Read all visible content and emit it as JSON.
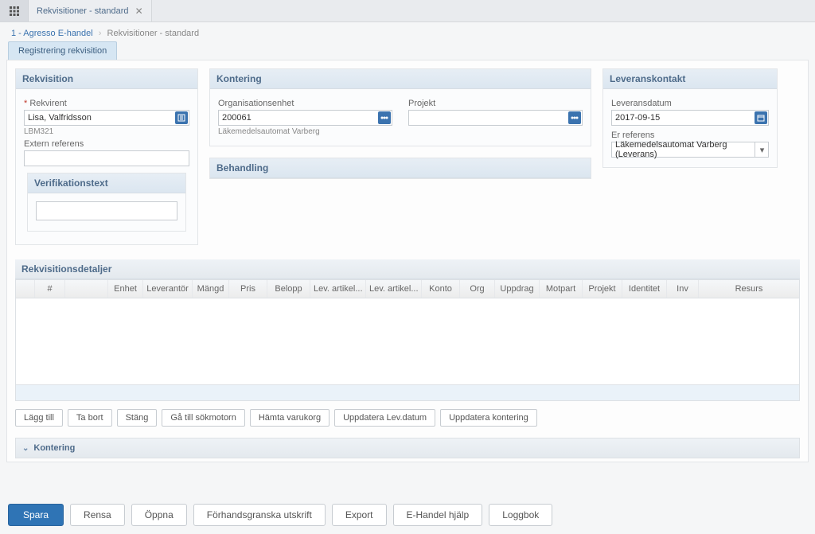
{
  "tab": {
    "title": "Rekvisitioner - standard"
  },
  "breadcrumb": {
    "root": "1 - Agresso E-handel",
    "current": "Rekvisitioner - standard"
  },
  "inner_tab": {
    "label": "Registrering rekvisition"
  },
  "rekvisition": {
    "heading": "Rekvisition",
    "rekvirent_label": "Rekvirent",
    "rekvirent_value": "Lisa, Valfridsson",
    "rekvirent_code": "LBM321",
    "extern_label": "Extern referens",
    "extern_value": "",
    "verif_heading": "Verifikationstext",
    "verif_value": ""
  },
  "kontering": {
    "heading": "Kontering",
    "org_label": "Organisationsenhet",
    "org_value": "200061",
    "org_desc": "Läkemedelsautomat Varberg",
    "projekt_label": "Projekt",
    "projekt_value": ""
  },
  "behandling": {
    "heading": "Behandling"
  },
  "leverans": {
    "heading": "Leveranskontakt",
    "date_label": "Leveransdatum",
    "date_value": "2017-09-15",
    "ref_label": "Er referens",
    "ref_value": "Läkemedelsautomat Varberg (Leverans)"
  },
  "details": {
    "heading": "Rekvisitionsdetaljer",
    "columns": [
      "#",
      "",
      "Enhet",
      "Leverantör",
      "Mängd",
      "Pris",
      "Belopp",
      "Lev. artikel...",
      "Lev. artikel...",
      "Konto",
      "Org",
      "Uppdrag",
      "Motpart",
      "Projekt",
      "Identitet",
      "Inv",
      "Resurs"
    ]
  },
  "row_actions": {
    "add": "Lägg till",
    "remove": "Ta bort",
    "close": "Stäng",
    "search": "Gå till sökmotorn",
    "cart": "Hämta varukorg",
    "upd_date": "Uppdatera Lev.datum",
    "upd_kont": "Uppdatera kontering"
  },
  "collapsible": {
    "label": "Kontering"
  },
  "footer": {
    "save": "Spara",
    "clear": "Rensa",
    "open": "Öppna",
    "preview": "Förhandsgranska utskrift",
    "export": "Export",
    "help": "E-Handel hjälp",
    "log": "Loggbok"
  }
}
